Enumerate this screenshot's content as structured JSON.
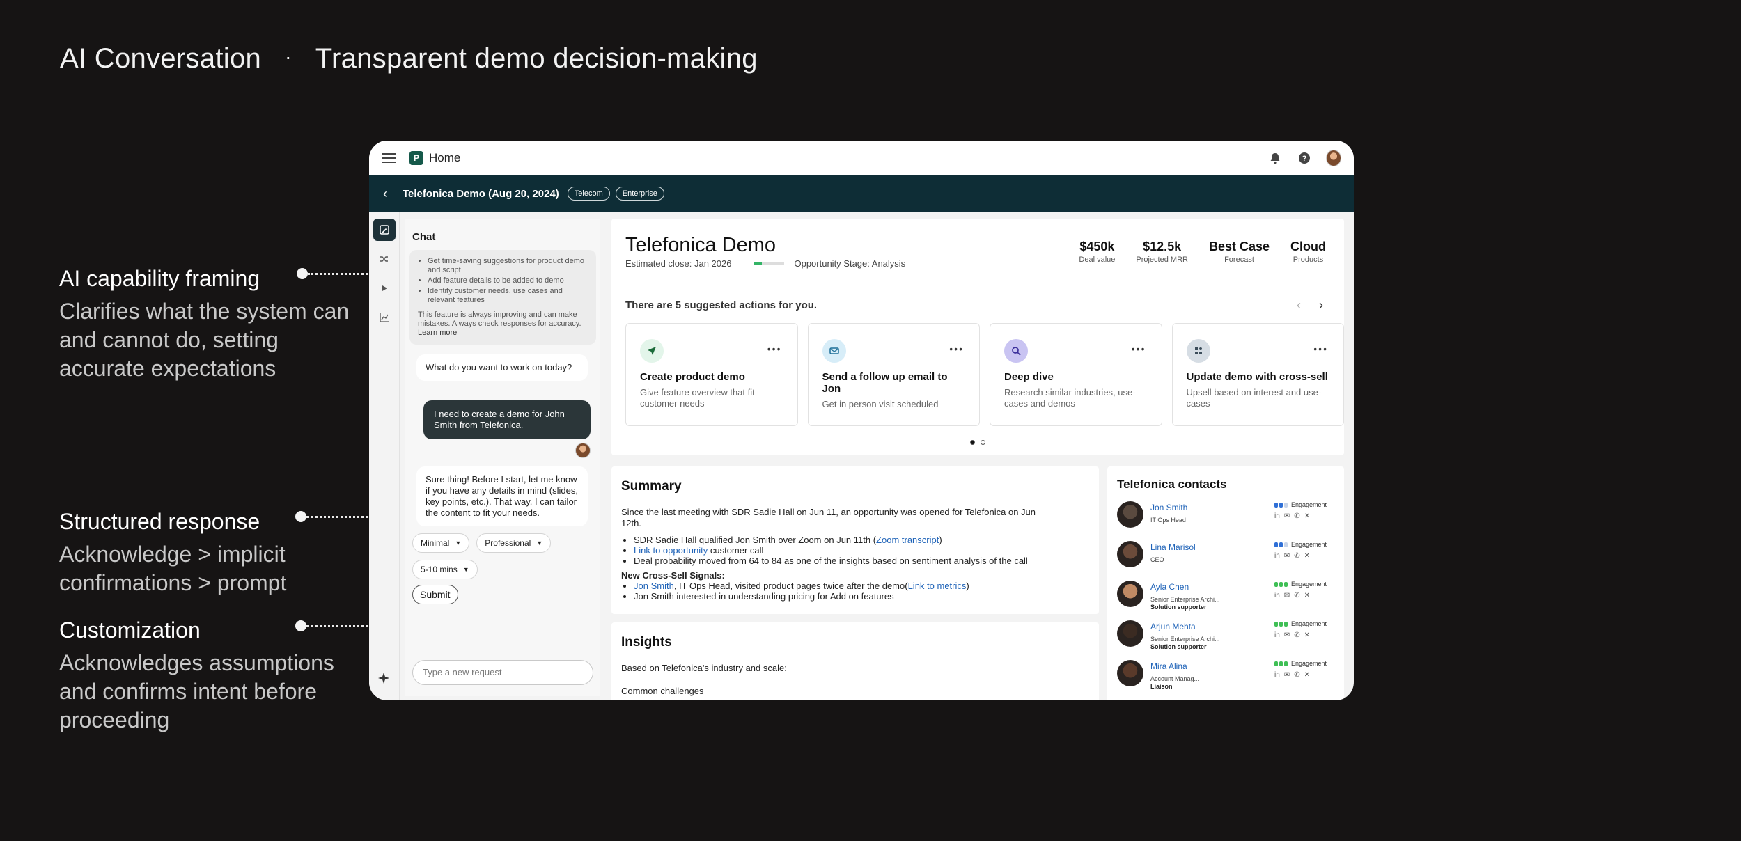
{
  "slide": {
    "title_left": "AI Conversation",
    "separator": "·",
    "title_right": "Transparent demo decision-making"
  },
  "annotations": [
    {
      "title": "AI capability framing",
      "body": "Clarifies what the system can and cannot do, setting accurate expectations"
    },
    {
      "title": "Structured response",
      "body": "Acknowledge > implicit confirmations > prompt"
    },
    {
      "title": "Customization",
      "body": "Acknowledges assumptions and confirms intent before proceeding"
    }
  ],
  "topbar": {
    "home_label": "Home",
    "logo_letter": "P"
  },
  "subbar": {
    "back": "‹",
    "title": "Telefonica Demo (Aug 20, 2024)",
    "tags": [
      "Telecom",
      "Enterprise"
    ]
  },
  "chat": {
    "heading": "Chat",
    "capabilities": [
      "Get time-saving suggestions for product demo and script",
      "Add feature details to be added to demo",
      "Identify customer needs, use cases and relevant features"
    ],
    "disclaimer": "This feature is always improving and can make mistakes. Always check responses for accuracy.",
    "learn_more": "Learn more",
    "ai_prompt": "What do you want to work on today?",
    "user_message": "I need to create a demo for John Smith from Telefonica.",
    "ai_response": "Sure thing! Before I start, let me know if you have any details in mind (slides, key points, etc.). That way, I can tailor the content to fit your needs.",
    "chips": [
      "Minimal",
      "Professional",
      "5-10 mins"
    ],
    "submit": "Submit",
    "input_placeholder": "Type a new request"
  },
  "demo": {
    "title": "Telefonica Demo",
    "estimated_close": "Estimated close: Jan 2026",
    "stage": "Opportunity Stage: Analysis",
    "metrics": [
      {
        "value": "$450k",
        "label": "Deal value"
      },
      {
        "value": "$12.5k",
        "label": "Projected MRR"
      },
      {
        "value": "Best Case",
        "label": "Forecast"
      },
      {
        "value": "Cloud",
        "label": "Products"
      }
    ],
    "suggest_label": "There are 5 suggested actions for you.",
    "cards": [
      {
        "title": "Create product demo",
        "desc": "Give feature overview that fit customer needs",
        "icon": "send-icon",
        "color": "#e3f5ea"
      },
      {
        "title": "Send a follow up email to Jon",
        "desc": "Get in person visit scheduled",
        "icon": "mail-icon",
        "color": "#d7edf8"
      },
      {
        "title": "Deep dive",
        "desc": "Research similar industries, use-cases and demos",
        "icon": "search-icon",
        "color": "#c9c4f2"
      },
      {
        "title": "Update demo with cross-sell",
        "desc": "Upsell based on interest and use-cases",
        "icon": "blocks-icon",
        "color": "#d6dde4"
      }
    ],
    "more": "•••"
  },
  "summary": {
    "heading": "Summary",
    "intro": "Since the last meeting with SDR Sadie Hall on Jun 11, an opportunity was opened for Telefonica on Jun 12th.",
    "b1_pre": "SDR Sadie Hall qualified Jon Smith over Zoom on Jun 11th (",
    "b1_link": "Zoom transcript",
    "b1_post": ")",
    "b2_link": "Link to opportunity",
    "b2_post": " customer call",
    "b3": "Deal probability moved from 64 to 84 as one of the insights based on sentiment analysis of the call",
    "signals_heading": "New Cross-Sell Signals:",
    "s1_link": "Jon Smith",
    "s1_mid": ", IT Ops Head, visited product pages twice after the demo(",
    "s1_link2": "Link to metrics",
    "s1_post": ")",
    "s2": "Jon Smith interested in understanding pricing for Add on features"
  },
  "insights": {
    "heading": "Insights",
    "intro": "Based on Telefonica's industry and scale:",
    "sub": "Common challenges"
  },
  "contacts": {
    "heading": "Telefonica contacts",
    "engagement_label": "Engagement",
    "list": [
      {
        "name": "Jon Smith",
        "role": "IT Ops Head",
        "tag": "",
        "eng": "blue"
      },
      {
        "name": "Lina Marisol",
        "role": "CEO",
        "tag": "",
        "eng": "blue"
      },
      {
        "name": "Ayla Chen",
        "role": "Senior Enterprise Archi...",
        "tag": "Solution supporter",
        "eng": "green"
      },
      {
        "name": "Arjun Mehta",
        "role": "Senior Enterprise Archi...",
        "tag": "Solution supporter",
        "eng": "green"
      },
      {
        "name": "Mira Alina",
        "role": "Account Manag...",
        "tag": "Liaison",
        "eng": "green"
      }
    ]
  }
}
